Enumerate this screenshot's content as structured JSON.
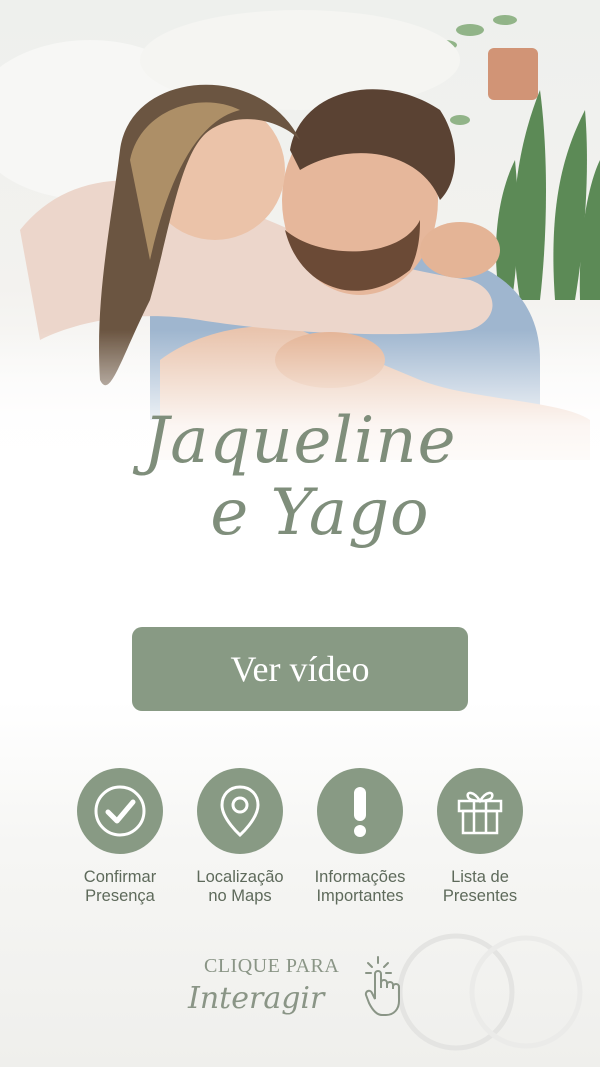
{
  "header": {
    "name_line1": "Jaqueline",
    "name_line2": "e Yago"
  },
  "video": {
    "label": "Ver vídeo"
  },
  "actions": [
    {
      "label": "Confirmar\nPresença",
      "icon": "check-circle-icon"
    },
    {
      "label": "Localização\nno Maps",
      "icon": "map-pin-icon"
    },
    {
      "label": "Informações\nImportantes",
      "icon": "exclamation-icon"
    },
    {
      "label": "Lista de\nPresentes",
      "icon": "gift-icon"
    }
  ],
  "cta": {
    "top": "CLIQUE PARA",
    "bottom": "Interagir"
  },
  "colors": {
    "accent": "#889a84",
    "text": "#5e6a5b",
    "script": "#7f8e7b"
  }
}
